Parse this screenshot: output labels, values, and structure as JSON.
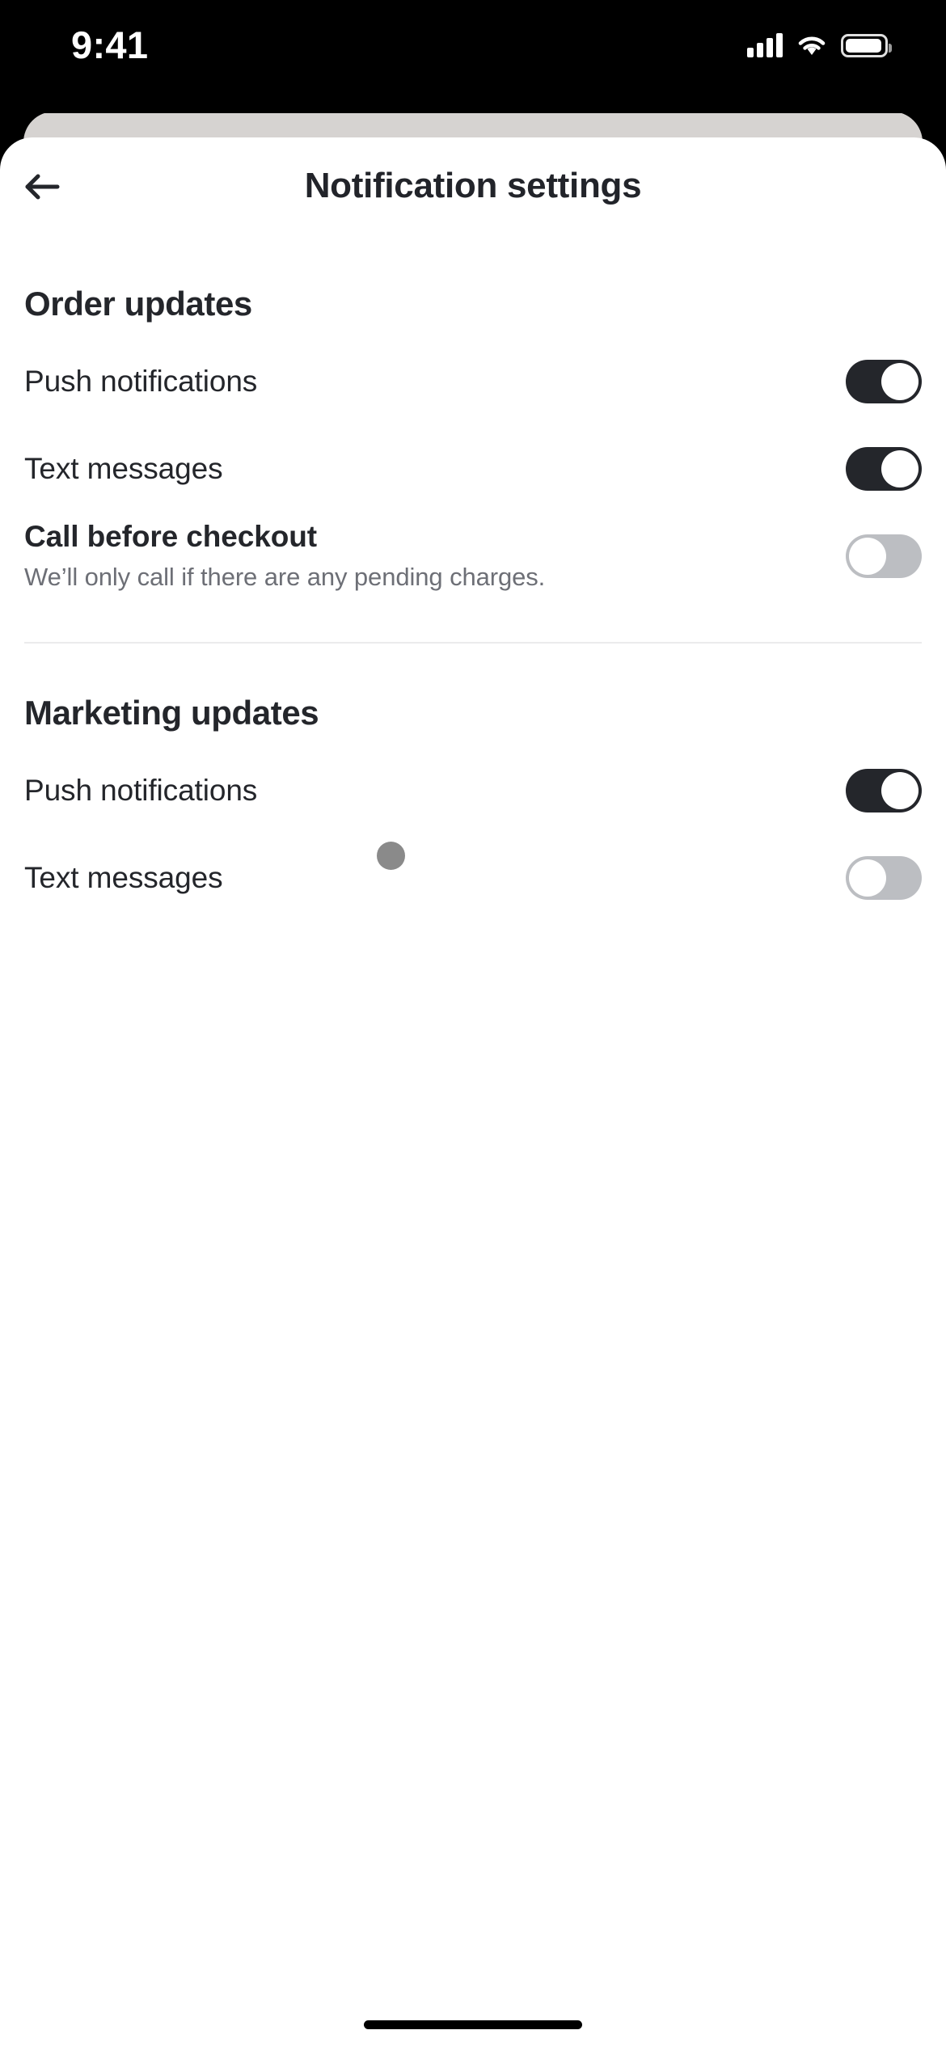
{
  "status_bar": {
    "time": "9:41",
    "cellular_icon": "cellular-signal-icon",
    "wifi_icon": "wifi-icon",
    "battery_icon": "battery-icon"
  },
  "navbar": {
    "back_icon": "back-arrow-icon",
    "title": "Notification settings"
  },
  "sections": [
    {
      "title": "Order updates",
      "rows": [
        {
          "label": "Push notifications",
          "sub": "",
          "toggle": "on",
          "emphasis": false
        },
        {
          "label": "Text messages",
          "sub": "",
          "toggle": "on",
          "emphasis": false
        },
        {
          "label": "Call before checkout",
          "sub": "We’ll only call if there are any pending charges.",
          "toggle": "off",
          "emphasis": true
        }
      ]
    },
    {
      "title": "Marketing updates",
      "rows": [
        {
          "label": "Push notifications",
          "sub": "",
          "toggle": "on",
          "emphasis": false
        },
        {
          "label": "Text messages",
          "sub": "",
          "toggle": "off",
          "emphasis": false
        }
      ]
    }
  ],
  "colors": {
    "toggle_on": "#24262b",
    "toggle_off": "#bcbec2",
    "knob": "#ffffff",
    "text_primary": "#24262b",
    "text_secondary": "#6d6f76",
    "divider": "#ebebec",
    "sheet_back": "#d6d3d1",
    "cursor": "#8a8a8a"
  },
  "cursor": {
    "name": "touch-cursor-indicator"
  },
  "home_indicator": {
    "name": "home-indicator"
  }
}
